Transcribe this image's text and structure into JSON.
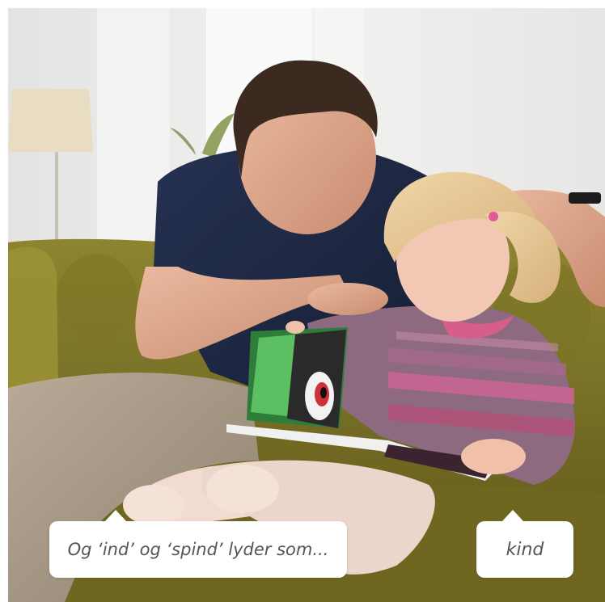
{
  "photo": {
    "subject": "photo",
    "icon": "photo-icon"
  },
  "captions": {
    "left_bubble": "Og ‘ind’ og ‘spind’ lyder som...",
    "right_bubble": "kind"
  },
  "colors": {
    "bubble_bg": "#ffffff",
    "caption_text": "#555555",
    "sofa_olive": "#8a7d2a",
    "shirt_navy": "#1f2b45",
    "sweater_pink": "#c0577a",
    "wall": "#eeeeec"
  }
}
